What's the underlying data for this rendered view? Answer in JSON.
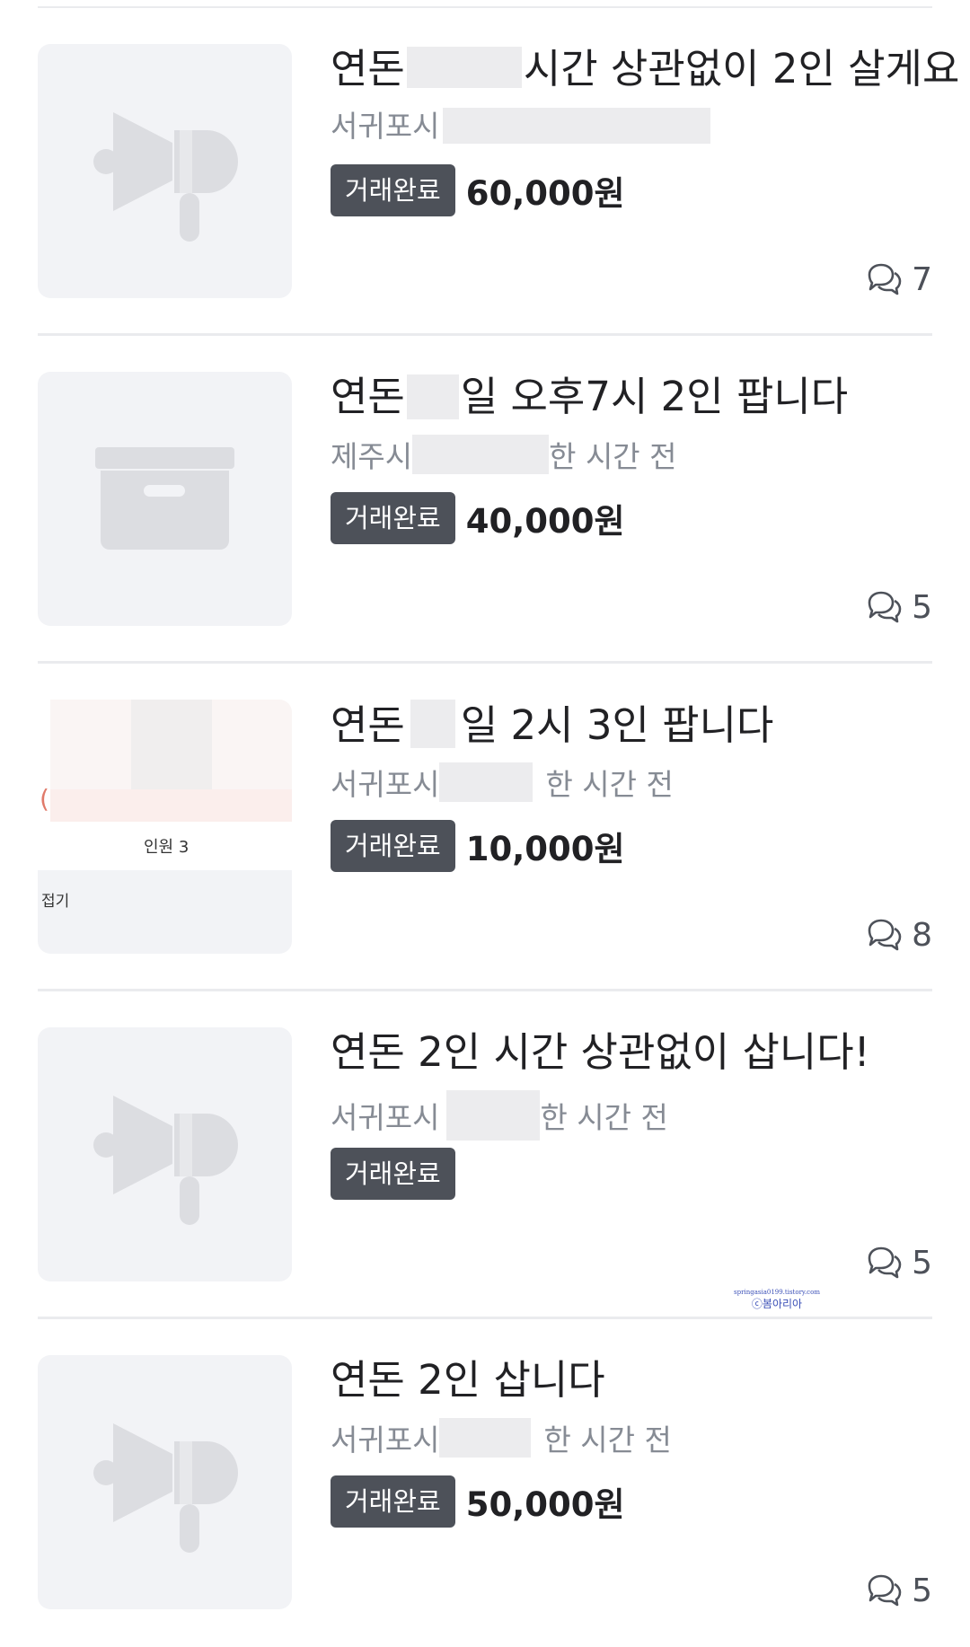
{
  "listings": [
    {
      "title_prefix": "연돈",
      "title_suffix": "시간 상관없이 2인 살게요",
      "location": "서귀포시",
      "time_ago": "",
      "status": "거래완료",
      "price": "60,000원",
      "comments": "7",
      "thumbnail": "megaphone-placeholder"
    },
    {
      "title_prefix": "연돈",
      "title_suffix": "일 오후7시 2인 팝니다",
      "location": "제주시",
      "time_ago": "한 시간 전",
      "status": "거래완료",
      "price": "40,000원",
      "comments": "5",
      "thumbnail": "box-placeholder"
    },
    {
      "title_prefix": "연돈",
      "title_suffix": "일 2시 3인 팝니다",
      "location": "서귀포시",
      "time_ago": "한 시간 전",
      "status": "거래완료",
      "price": "10,000원",
      "comments": "8",
      "thumbnail": "screenshot-photo",
      "thumb_text": {
        "people": "인원 3",
        "fold": "접기"
      }
    },
    {
      "title_prefix": "연돈 2인 시간 상관없이 삽니다!",
      "title_suffix": "",
      "location": "서귀포시",
      "time_ago": "한 시간 전",
      "status": "거래완료",
      "price": "",
      "comments": "5",
      "thumbnail": "megaphone-placeholder"
    },
    {
      "title_prefix": "연돈 2인 삽니다",
      "title_suffix": "",
      "location": "서귀포시",
      "time_ago": "한 시간 전",
      "status": "거래완료",
      "price": "50,000원",
      "comments": "5",
      "thumbnail": "megaphone-placeholder"
    }
  ],
  "watermark": {
    "url": "springasia0199.tistory.com",
    "name": "ⓒ봄아리아"
  },
  "colors": {
    "badge_bg": "#4d5159",
    "placeholder_bg": "#f2f3f6",
    "placeholder_icon": "#dcdde1",
    "meta_text": "#868b94"
  }
}
